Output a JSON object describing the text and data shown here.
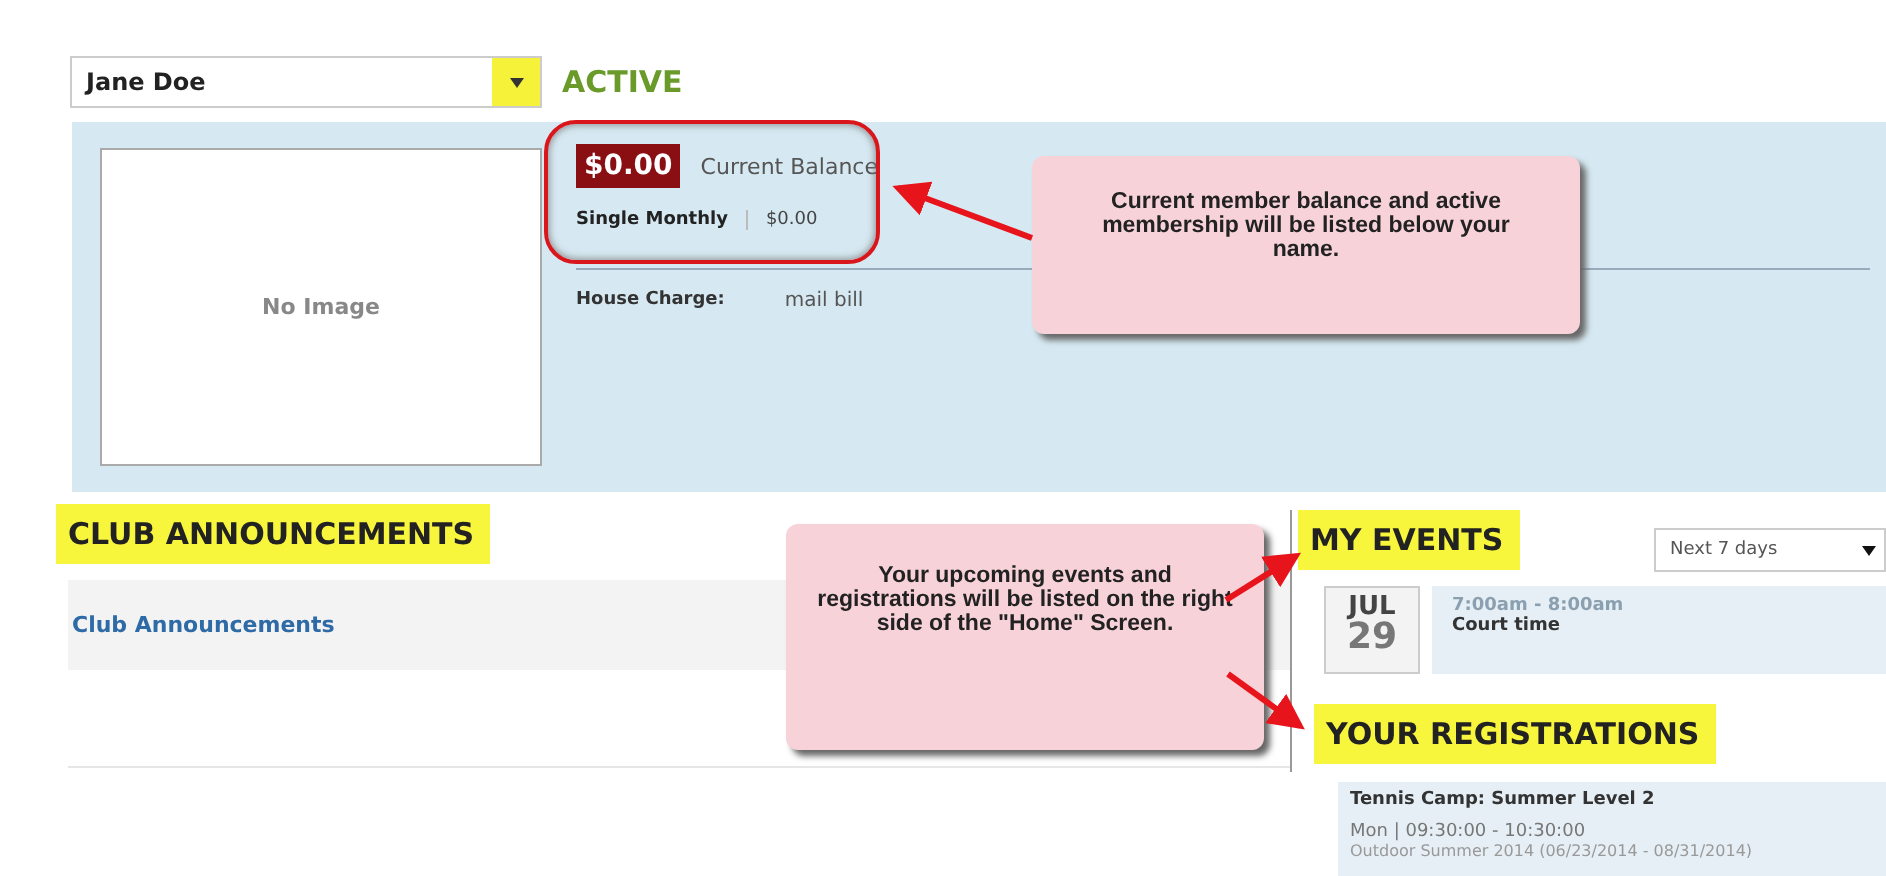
{
  "member": {
    "name": "Jane Doe",
    "status": "ACTIVE"
  },
  "profile": {
    "image_text": "No Image",
    "balance": "$0.00",
    "balance_label": "Current Balance",
    "membership": "Single Monthly",
    "membership_price": "$0.00",
    "house_charge_label": "House Charge:",
    "house_charge_value": "mail bill"
  },
  "announcements": {
    "heading": "CLUB ANNOUNCEMENTS",
    "items": [
      "Club Announcements"
    ]
  },
  "events": {
    "heading": "MY EVENTS",
    "range": "Next 7 days",
    "items": [
      {
        "month": "JUL",
        "day": "29",
        "time": "7:00am - 8:00am",
        "title": "Court time"
      }
    ]
  },
  "registrations": {
    "heading": "YOUR REGISTRATIONS",
    "items": [
      {
        "title": "Tennis Camp: Summer Level 2",
        "schedule": "Mon | 09:30:00 - 10:30:00",
        "session": "Outdoor Summer 2014 (06/23/2014 - 08/31/2014)"
      }
    ]
  },
  "callouts": [
    "Current member balance and active membership will be listed below your name.",
    "Your upcoming events and registrations will be listed on the right side of the \"Home\" Screen."
  ]
}
